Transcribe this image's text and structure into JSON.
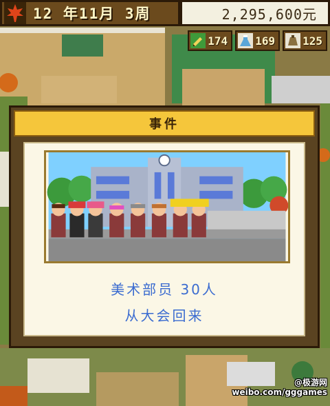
{
  "hud": {
    "date": "12 年11月 3周",
    "money": "2,295,600元",
    "stats": [
      {
        "icon": "pencil-icon",
        "value": "174"
      },
      {
        "icon": "flask-icon",
        "value": "169"
      },
      {
        "icon": "weight-icon",
        "value": "125"
      }
    ]
  },
  "dialog": {
    "title": "事件",
    "line1": "美术部员 30人",
    "line2": "从大会回来"
  },
  "watermark": {
    "line1": "@极游网",
    "line2": "weibo.com/gggames"
  },
  "colors": {
    "accent": "#f5c63b",
    "message_text": "#3a6bd0",
    "frame": "#5a4321"
  }
}
